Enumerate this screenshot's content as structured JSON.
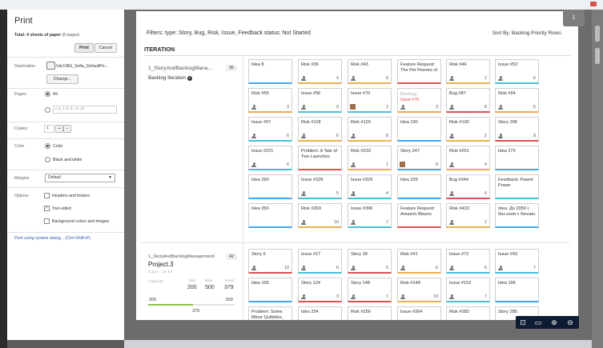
{
  "print": {
    "title": "Print",
    "total_bold": "Total: 4 sheets of paper",
    "total_rest": " (8 pages)",
    "print_button": "Print",
    "cancel_button": "Cancel",
    "destination_label": "Destination",
    "destination_value": "\\\\dc1\\BG_Sofia_DefaultPri...",
    "change_button": "Change...",
    "pages_label": "Pages",
    "pages_all": "All",
    "pages_placeholder": "e.g. 1-5, 8, 11-13",
    "copies_label": "Copies",
    "copies_value": "1",
    "plus": "+",
    "minus": "–",
    "color_label": "Color",
    "color_option": "Color",
    "bw_option": "Black and white",
    "margins_label": "Margins",
    "margins_value": "Default",
    "options_label": "Options",
    "headers_footers": "Headers and footers",
    "two_sided": "Two-sided",
    "background": "Background colors and images",
    "system_dialog": "Print using system dialog... (Ctrl+Shift+P)"
  },
  "preview": {
    "page_number": "1",
    "filters": "Filters: type: Story, Bug, Risk, Issue, Feedback  status: Not Started",
    "sort_by": "Sort By: Backlog Priority    Rows:",
    "iteration_header": "ITERATION",
    "section1": {
      "name": "1_StoryAndBacklogMana...",
      "count": "36",
      "subtitle": "Backlog Iteration"
    },
    "section2": {
      "name": "1_StoryAndBacklogManagement\\",
      "count": "42",
      "project": "Project.3",
      "dates": "2 Jun – 13 Jul",
      "capacity_label": "Capacity",
      "min_label": "Min.",
      "max_label": "Max.",
      "used_label": "Used",
      "min_value": "200",
      "max_value": "500",
      "used_value": "379",
      "bar_left": "200",
      "bar_right": "500",
      "bar_value": "379",
      "progress_percent": 52
    },
    "rows1": [
      [
        {
          "title": "Idea 8",
          "num": "",
          "color": "blue",
          "avatar": "none"
        },
        {
          "title": "Risk #36",
          "num": "4",
          "color": "orange",
          "avatar": "person"
        },
        {
          "title": "Risk #43",
          "num": "9",
          "color": "orange",
          "avatar": "person"
        },
        {
          "title": "Feature Request: The Pet Peeves of",
          "num": "",
          "color": "red",
          "avatar": "none"
        },
        {
          "title": "Risk #46",
          "num": "2",
          "color": "orange",
          "avatar": "person"
        },
        {
          "title": "Issue #52",
          "num": "6",
          "color": "cyan",
          "avatar": "person"
        }
      ],
      [
        {
          "title": "Risk #55",
          "num": "3",
          "color": "orange",
          "avatar": "person"
        },
        {
          "title": "Issue #56",
          "num": "9",
          "color": "cyan",
          "avatar": "person"
        },
        {
          "title": "Issue #70",
          "num": "1",
          "color": "cyan",
          "avatar": "photo"
        },
        {
          "title": "",
          "num": "3",
          "color": "orange",
          "avatar": "person",
          "blocking": "Blocking",
          "redref": "Issue #79"
        },
        {
          "title": "Bug #87",
          "num": "8",
          "color": "red",
          "avatar": "person"
        },
        {
          "title": "Risk #94",
          "num": "6",
          "color": "orange",
          "avatar": "person"
        }
      ],
      [
        {
          "title": "Issue #97",
          "num": "6",
          "color": "cyan",
          "avatar": "person"
        },
        {
          "title": "Risk #118",
          "num": "6",
          "color": "orange",
          "avatar": "person"
        },
        {
          "title": "Risk #120",
          "num": "8",
          "color": "orange",
          "avatar": "person"
        },
        {
          "title": "Idea 130",
          "num": "",
          "color": "blue",
          "avatar": "none"
        },
        {
          "title": "Risk #192",
          "num": "2",
          "color": "orange",
          "avatar": "person"
        },
        {
          "title": "Story 206",
          "num": "8",
          "color": "red",
          "avatar": "person"
        }
      ],
      [
        {
          "title": "Issue #221",
          "num": "6",
          "color": "cyan",
          "avatar": "person"
        },
        {
          "title": "Problem: A Tale of Two Launches",
          "num": "",
          "color": "red",
          "avatar": "none"
        },
        {
          "title": "Risk #233",
          "num": "1",
          "color": "orange",
          "avatar": "person"
        },
        {
          "title": "Story 247",
          "num": "9",
          "color": "blue",
          "avatar": "photo"
        },
        {
          "title": "Risk #251",
          "num": "4",
          "color": "orange",
          "avatar": "person"
        },
        {
          "title": "Idea 273",
          "num": "",
          "color": "blue",
          "avatar": "none"
        }
      ],
      [
        {
          "title": "Idea 290",
          "num": "",
          "color": "blue",
          "avatar": "none"
        },
        {
          "title": "Issue #328",
          "num": "5",
          "color": "cyan",
          "avatar": "person"
        },
        {
          "title": "Issue #329",
          "num": "4",
          "color": "cyan",
          "avatar": "person"
        },
        {
          "title": "Idea 339",
          "num": "",
          "color": "blue",
          "avatar": "none"
        },
        {
          "title": "Bug #344",
          "num": "6",
          "color": "red",
          "avatar": "person"
        },
        {
          "title": "Feedback: Patent Power",
          "num": "",
          "color": "cyan",
          "avatar": "none"
        }
      ],
      [
        {
          "title": "Idea 350",
          "num": "",
          "color": "blue",
          "avatar": "none"
        },
        {
          "title": "Risk #363",
          "num": "10",
          "color": "orange",
          "avatar": "person"
        },
        {
          "title": "Issue #396",
          "num": "7",
          "color": "cyan",
          "avatar": "person"
        },
        {
          "title": "Feature Request: Amazon Blazes",
          "num": "",
          "color": "red",
          "avatar": "none"
        },
        {
          "title": "Risk #433",
          "num": "2",
          "color": "orange",
          "avatar": "person"
        },
        {
          "title": "Idea: До 2050 г. без коли с бензин.",
          "num": "",
          "color": "blue",
          "avatar": "none"
        }
      ]
    ],
    "rows2": [
      [
        {
          "title": "Story 6",
          "num": "10",
          "color": "red",
          "avatar": "person"
        },
        {
          "title": "Issue #27",
          "num": "6",
          "color": "cyan",
          "avatar": "person"
        },
        {
          "title": "Story 28",
          "num": "5",
          "color": "red",
          "avatar": "person"
        },
        {
          "title": "Risk #41",
          "num": "6",
          "color": "orange",
          "avatar": "person"
        },
        {
          "title": "Issue #72",
          "num": "6",
          "color": "cyan",
          "avatar": "person"
        },
        {
          "title": "Issue #93",
          "num": "7",
          "color": "cyan",
          "avatar": "person"
        }
      ],
      [
        {
          "title": "Idea 105",
          "num": "",
          "color": "blue",
          "avatar": "none"
        },
        {
          "title": "Story 124",
          "num": "3",
          "color": "red",
          "avatar": "person"
        },
        {
          "title": "Story 148",
          "num": "7",
          "color": "red",
          "avatar": "person"
        },
        {
          "title": "Risk #148",
          "num": "10",
          "color": "orange",
          "avatar": "person"
        },
        {
          "title": "Issue #152",
          "num": "7",
          "color": "cyan",
          "avatar": "person"
        },
        {
          "title": "Idea 198",
          "num": "",
          "color": "blue",
          "avatar": "none"
        }
      ],
      [
        {
          "title": "Problem: Some Minor Quibbles,",
          "num": "",
          "color": "red",
          "avatar": "none"
        },
        {
          "title": "Idea 234",
          "num": "",
          "color": "blue",
          "avatar": "none"
        },
        {
          "title": "Risk #256",
          "num": "",
          "color": "orange",
          "avatar": "none"
        },
        {
          "title": "Issue #264",
          "num": "",
          "color": "cyan",
          "avatar": "none"
        },
        {
          "title": "Risk #282",
          "num": "",
          "color": "orange",
          "avatar": "none"
        },
        {
          "title": "Story 285",
          "num": "",
          "color": "red",
          "avatar": "none"
        }
      ]
    ]
  }
}
